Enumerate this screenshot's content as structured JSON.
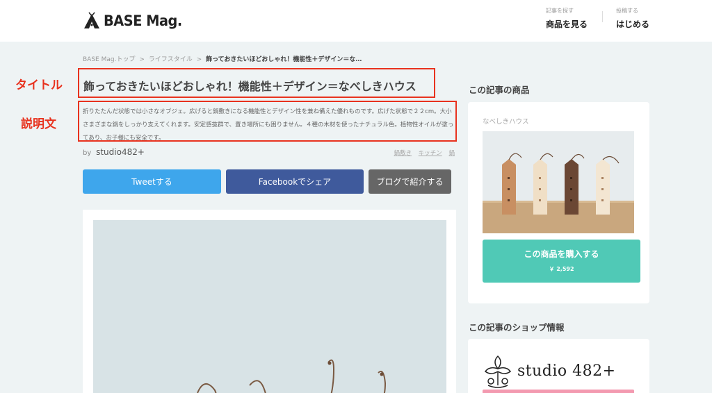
{
  "header": {
    "logo_text": "BASE Mag.",
    "nav": [
      {
        "sub": "記事を探す",
        "main": "商品を見る"
      },
      {
        "sub": "投稿する",
        "main": "はじめる"
      }
    ]
  },
  "breadcrumb": {
    "items": [
      "BASE Mag.トップ",
      "ライフスタイル"
    ],
    "current": "飾っておきたいほどおしゃれ！機能性＋デザイン＝な…",
    "separator": ">"
  },
  "annotations": {
    "title_label": "タイトル",
    "desc_label": "説明文",
    "color": "#e8321e"
  },
  "article": {
    "title": "飾っておきたいほどおしゃれ！機能性＋デザイン＝なべしきハウス",
    "description": "折りたたんだ状態では小さなオブジェ。広げると鍋敷きになる機能性とデザイン性を兼ね備えた優れものです。広げた状態で２２cm。大小さまざまな鍋をしっかり支えてくれます。安定感抜群で、置き場所にも困りません。４種の木材を使ったナチュラル色。植物性オイルが塗ってあり、お子様にも安全です。",
    "author_prefix": "by",
    "author": "studio482+",
    "tags": [
      "鍋敷き",
      "キッチン",
      "鍋"
    ]
  },
  "share": {
    "tweet": "Tweetする",
    "facebook": "Facebookでシェア",
    "blog": "ブログで紹介する",
    "colors": {
      "tweet": "#3ea6ec",
      "facebook": "#3f5a9c",
      "blog": "#666666"
    }
  },
  "sidebar": {
    "product_heading": "この記事の商品",
    "product_name": "なべしきハウス",
    "buy_label": "この商品を購入する",
    "price": "￥ 2,592",
    "buy_color": "#50c9b6",
    "shop_heading": "この記事のショップ情報",
    "shop_name": "studio 482+"
  }
}
